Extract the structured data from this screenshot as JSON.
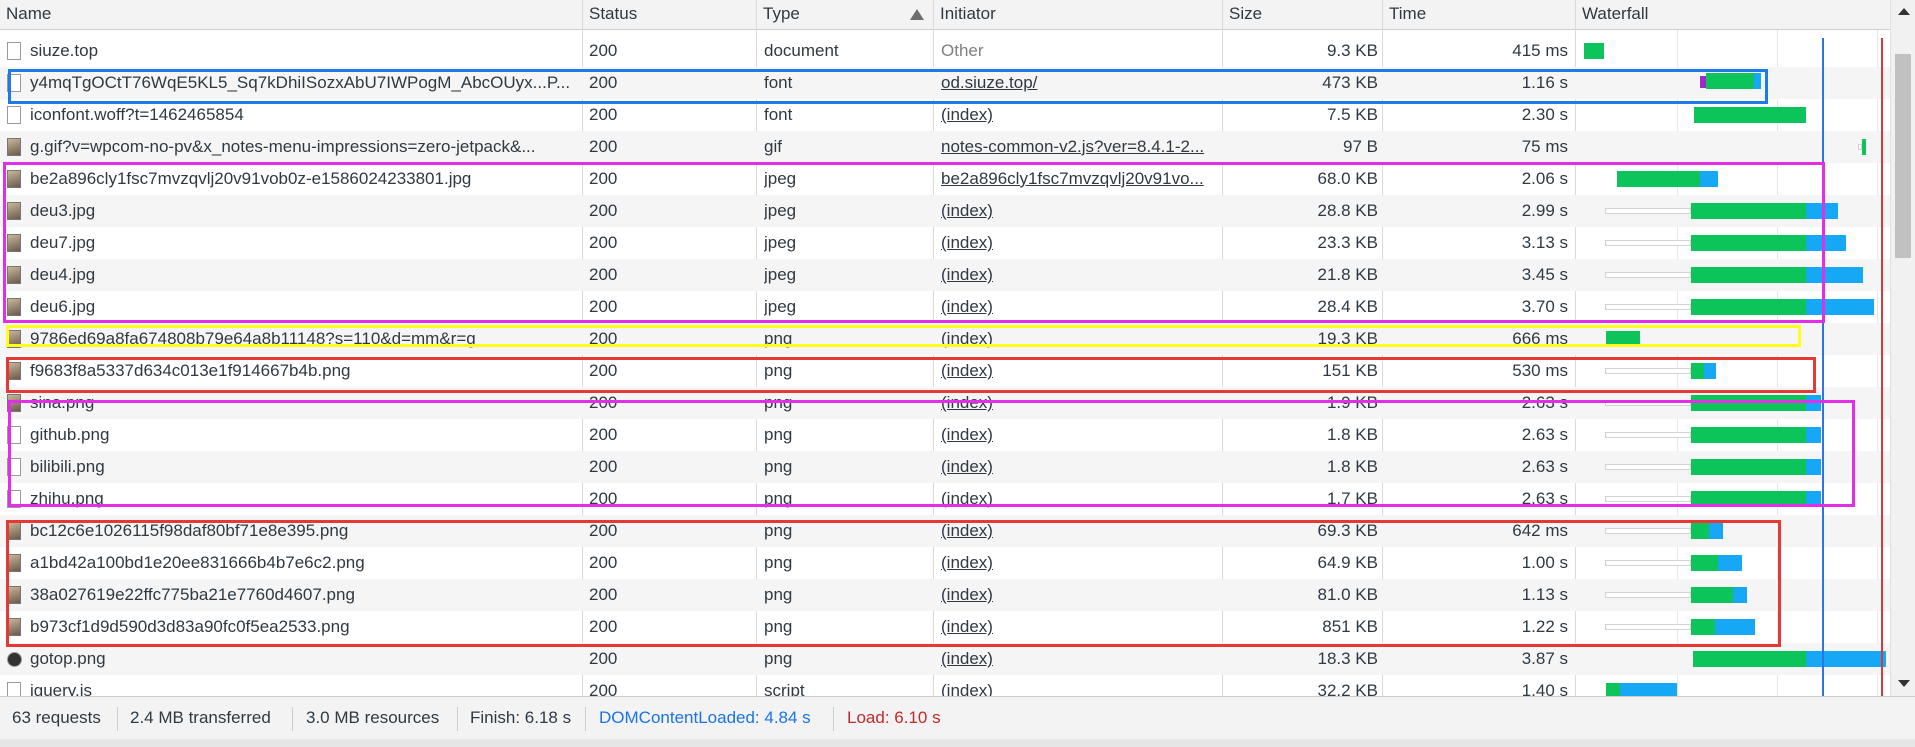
{
  "columns": {
    "name": "Name",
    "status": "Status",
    "type": "Type",
    "initiator": "Initiator",
    "size": "Size",
    "time": "Time",
    "waterfall": "Waterfall"
  },
  "sort_indicator": "up-arrow-icon",
  "rows": [
    {
      "name": "siuze.top",
      "status": "200",
      "type": "document",
      "initiator": "Other",
      "size": "9.3 KB",
      "time": "415 ms",
      "icon": "document-icon"
    },
    {
      "name": "y4mqTgOCtT76WqE5KL5_Sq7kDhiISozxAbU7IWPogM_AbcOUyx...P...",
      "status": "200",
      "type": "font",
      "initiator": "od.siuze.top/",
      "size": "473 KB",
      "time": "1.16 s",
      "icon": "file-icon"
    },
    {
      "name": "iconfont.woff?t=1462465854",
      "status": "200",
      "type": "font",
      "initiator": "(index)",
      "size": "7.5 KB",
      "time": "2.30 s",
      "icon": "file-icon"
    },
    {
      "name": "g.gif?v=wpcom-no-pv&x_notes-menu-impressions=zero-jetpack&...",
      "status": "200",
      "type": "gif",
      "initiator": "notes-common-v2.js?ver=8.4.1-2...",
      "size": "97 B",
      "time": "75 ms",
      "icon": "image-icon"
    },
    {
      "name": "be2a896cly1fsc7mvzqvlj20v91vob0z-e1586024233801.jpg",
      "status": "200",
      "type": "jpeg",
      "initiator": "be2a896cly1fsc7mvzqvlj20v91vo...",
      "size": "68.0 KB",
      "time": "2.06 s",
      "icon": "image-icon"
    },
    {
      "name": "deu3.jpg",
      "status": "200",
      "type": "jpeg",
      "initiator": "(index)",
      "size": "28.8 KB",
      "time": "2.99 s",
      "icon": "image-icon"
    },
    {
      "name": "deu7.jpg",
      "status": "200",
      "type": "jpeg",
      "initiator": "(index)",
      "size": "23.3 KB",
      "time": "3.13 s",
      "icon": "image-icon"
    },
    {
      "name": "deu4.jpg",
      "status": "200",
      "type": "jpeg",
      "initiator": "(index)",
      "size": "21.8 KB",
      "time": "3.45 s",
      "icon": "image-icon"
    },
    {
      "name": "deu6.jpg",
      "status": "200",
      "type": "jpeg",
      "initiator": "(index)",
      "size": "28.4 KB",
      "time": "3.70 s",
      "icon": "image-icon"
    },
    {
      "name": "9786ed69a8fa674808b79e64a8b11148?s=110&d=mm&r=g",
      "status": "200",
      "type": "png",
      "initiator": "(index)",
      "size": "19.3 KB",
      "time": "666 ms",
      "icon": "image-icon"
    },
    {
      "name": "f9683f8a5337d634c013e1f914667b4b.png",
      "status": "200",
      "type": "png",
      "initiator": "(index)",
      "size": "151 KB",
      "time": "530 ms",
      "icon": "image-icon"
    },
    {
      "name": "sina.png",
      "status": "200",
      "type": "png",
      "initiator": "(index)",
      "size": "1.9 KB",
      "time": "2.63 s",
      "icon": "image-icon"
    },
    {
      "name": "github.png",
      "status": "200",
      "type": "png",
      "initiator": "(index)",
      "size": "1.8 KB",
      "time": "2.63 s",
      "icon": "image-icon"
    },
    {
      "name": "bilibili.png",
      "status": "200",
      "type": "png",
      "initiator": "(index)",
      "size": "1.8 KB",
      "time": "2.63 s",
      "icon": "image-icon"
    },
    {
      "name": "zhihu.png",
      "status": "200",
      "type": "png",
      "initiator": "(index)",
      "size": "1.7 KB",
      "time": "2.63 s",
      "icon": "image-icon"
    },
    {
      "name": "bc12c6e1026115f98daf80bf71e8e395.png",
      "status": "200",
      "type": "png",
      "initiator": "(index)",
      "size": "69.3 KB",
      "time": "642 ms",
      "icon": "image-icon"
    },
    {
      "name": "a1bd42a100bd1e20ee831666b4b7e6c2.png",
      "status": "200",
      "type": "png",
      "initiator": "(index)",
      "size": "64.9 KB",
      "time": "1.00 s",
      "icon": "image-icon"
    },
    {
      "name": "38a027619e22ffc775ba21e7760d4607.png",
      "status": "200",
      "type": "png",
      "initiator": "(index)",
      "size": "81.0 KB",
      "time": "1.13 s",
      "icon": "image-icon"
    },
    {
      "name": "b973cf1d9d590d3d83a90fc0f5ea2533.png",
      "status": "200",
      "type": "png",
      "initiator": "(index)",
      "size": "851 KB",
      "time": "1.22 s",
      "icon": "image-icon"
    },
    {
      "name": "gotop.png",
      "status": "200",
      "type": "png",
      "initiator": "(index)",
      "size": "18.3 KB",
      "time": "3.87 s",
      "icon": "image-icon"
    },
    {
      "name": "jquery.js",
      "status": "200",
      "type": "script",
      "initiator": "(index)",
      "size": "32.2 KB",
      "time": "1.40 s",
      "icon": "file-icon"
    }
  ],
  "footer": {
    "requests": "63 requests",
    "transferred": "2.4 MB transferred",
    "resources": "3.0 MB resources",
    "finish": "Finish: 6.18 s",
    "dcl": "DOMContentLoaded: 4.84 s",
    "load": "Load: 6.10 s"
  },
  "colors": {
    "waiting": "#ffffff",
    "download_green": "#0cc459",
    "receive_blue": "#16a7f5",
    "dcl_line": "#2f74e0",
    "load_line": "#d83a3a",
    "highlight_blue": "#1e7be6",
    "highlight_magenta": "#e22ee6",
    "highlight_yellow": "#ffff1a",
    "highlight_red": "#e53935"
  }
}
